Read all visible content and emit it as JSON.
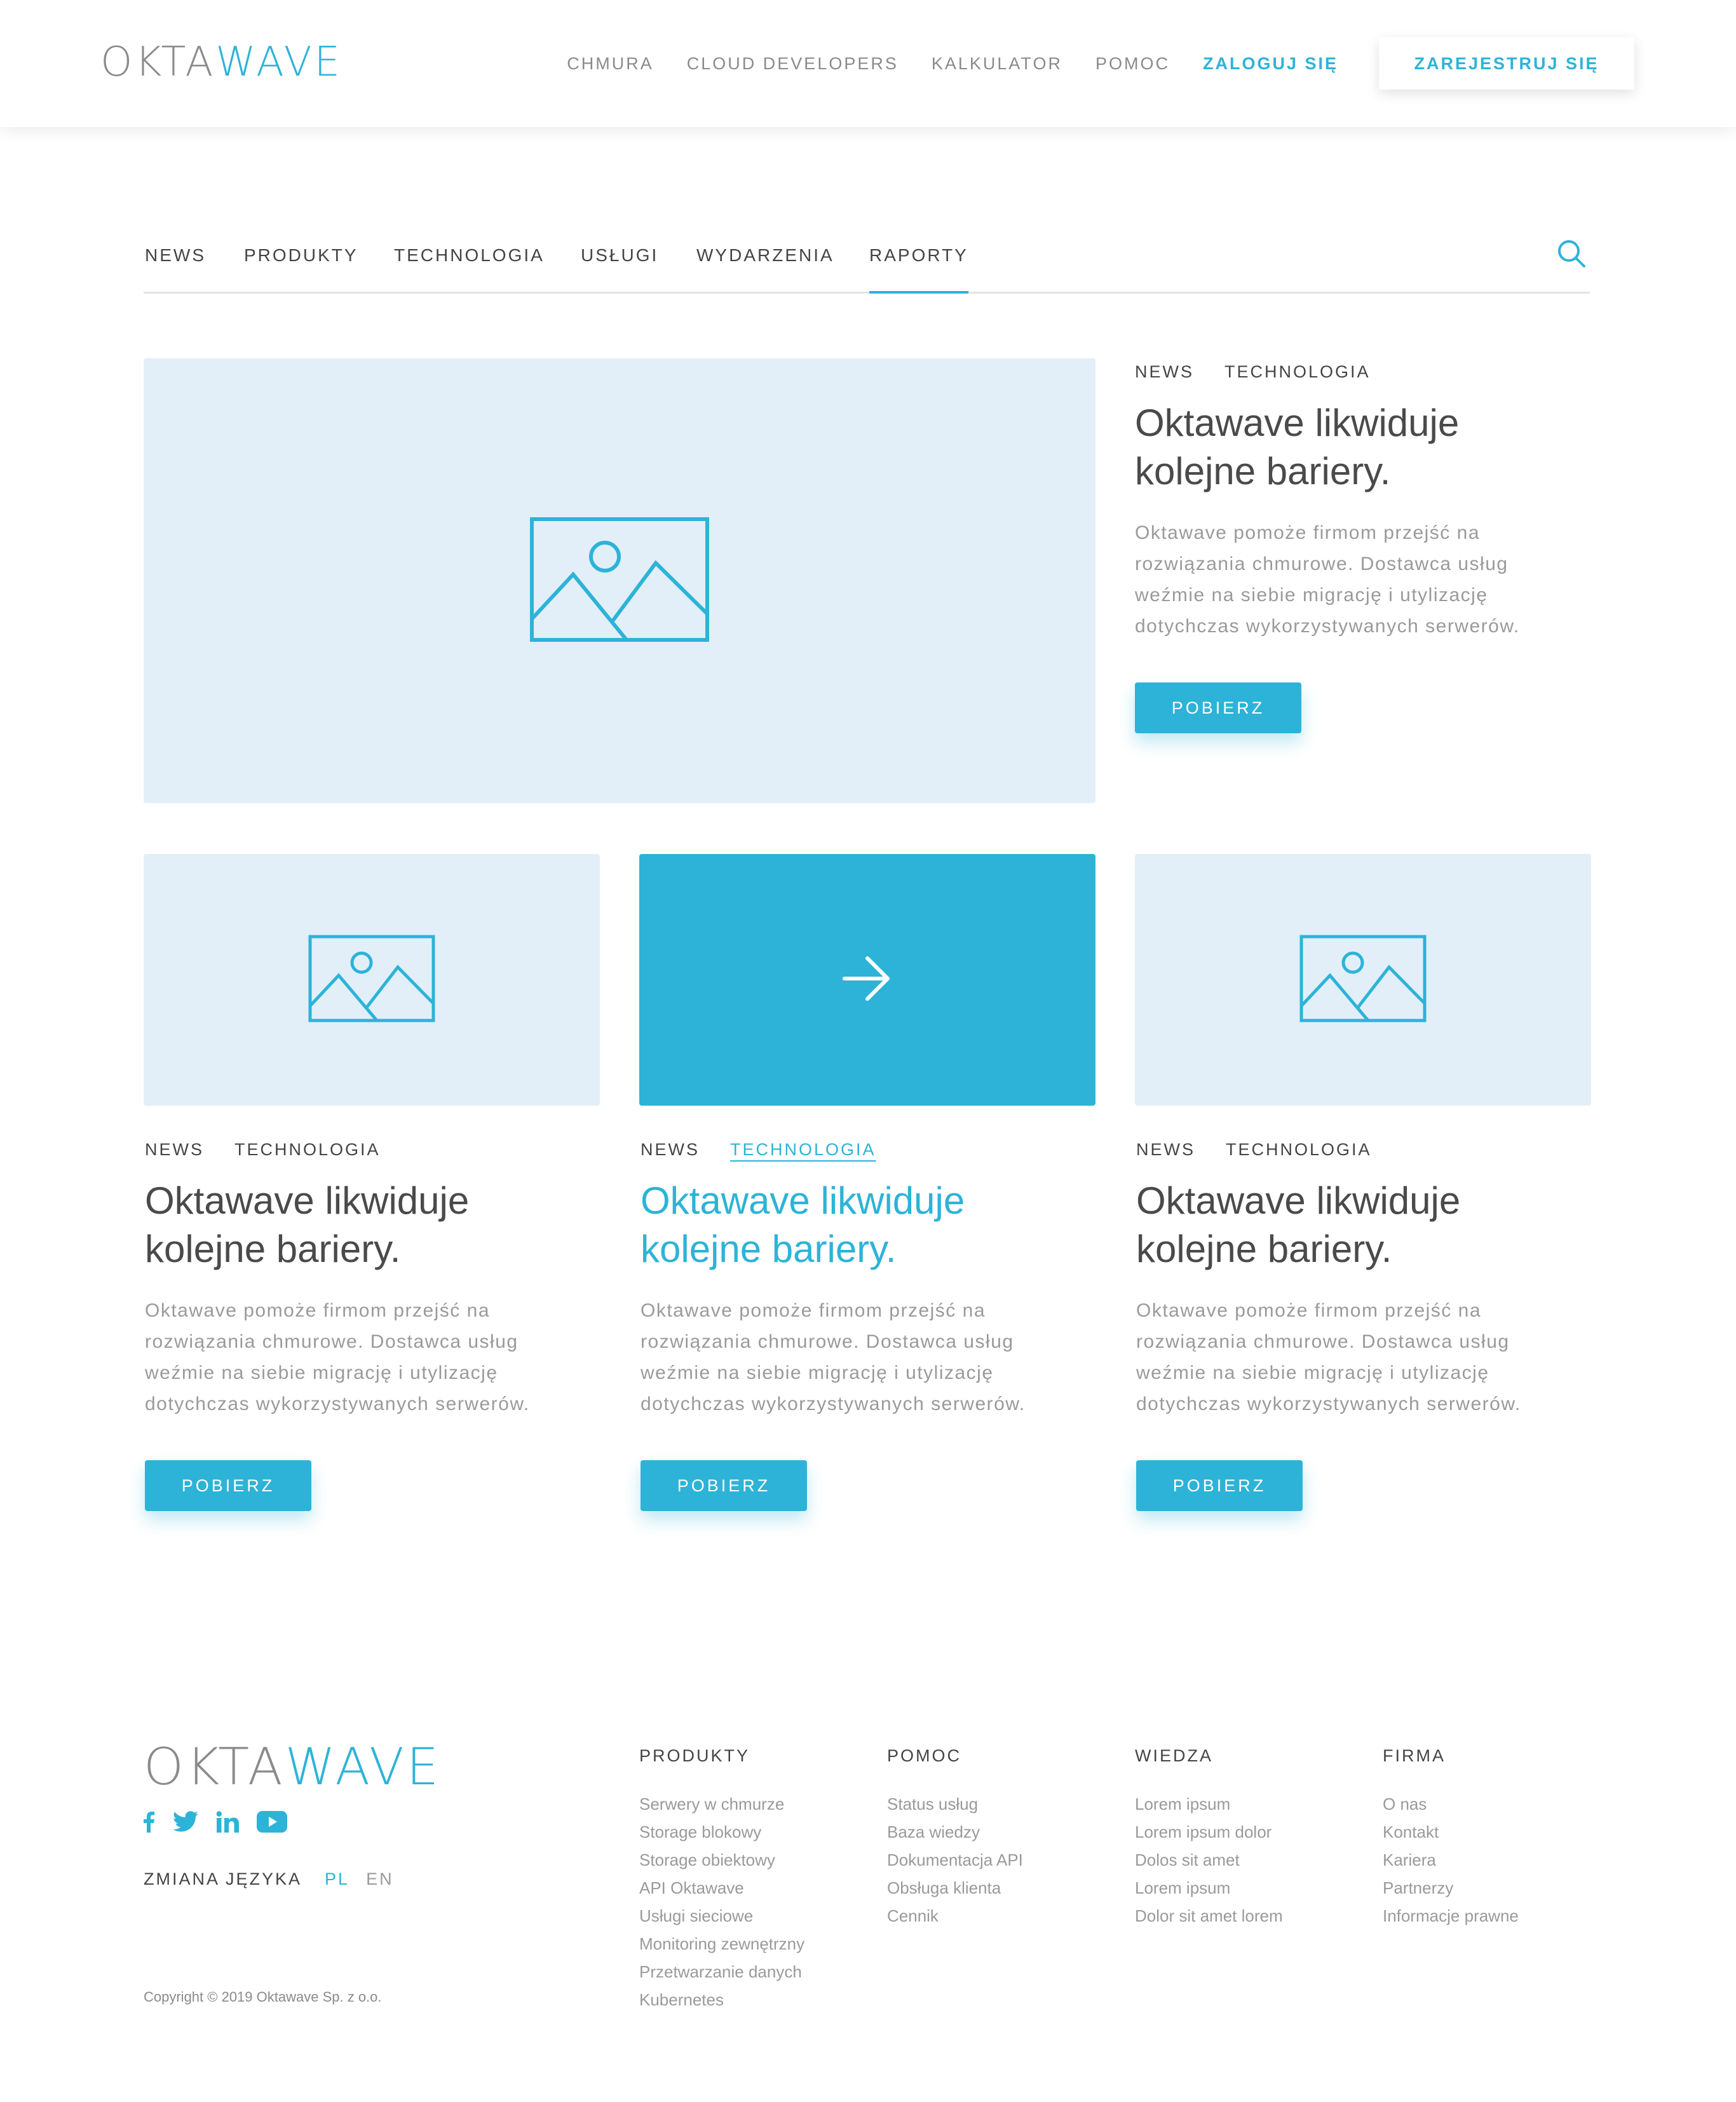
{
  "header": {
    "logo": {
      "part1": "OKTA",
      "part2": "WAVE"
    },
    "nav": [
      {
        "label": "CHMURA"
      },
      {
        "label": "CLOUD DEVELOPERS"
      },
      {
        "label": "KALKULATOR"
      },
      {
        "label": "POMOC"
      }
    ],
    "login": "ZALOGUJ SIĘ",
    "register": "ZAREJESTRUJ SIĘ"
  },
  "categories": {
    "tabs": [
      "NEWS",
      "PRODUKTY",
      "TECHNOLOGIA",
      "USŁUGI",
      "WYDARZENIA",
      "RAPORTY"
    ],
    "active": "RAPORTY"
  },
  "featured": {
    "tags": [
      "NEWS",
      "TECHNOLOGIA"
    ],
    "title_line1": "Oktawave likwiduje",
    "title_line2": "kolejne bariery.",
    "desc_lines": [
      "Oktawave pomoże firmom przejść na",
      "rozwiązania chmurowe. Dostawca usług",
      "weźmie na siebie migrację i utylizację",
      "dotychczas wykorzystywanych serwerów."
    ],
    "button": "POBIERZ"
  },
  "cards": [
    {
      "tags": [
        "NEWS",
        "TECHNOLOGIA"
      ],
      "title_line1": "Oktawave likwiduje",
      "title_line2": "kolejne bariery.",
      "desc_lines": [
        "Oktawave pomoże firmom przejść na",
        "rozwiązania chmurowe. Dostawca usług",
        "weźmie na siebie migrację i utylizację",
        "dotychczas wykorzystywanych serwerów."
      ],
      "button": "POBIERZ"
    },
    {
      "tags": [
        "NEWS",
        "TECHNOLOGIA"
      ],
      "title_line1": "Oktawave likwiduje",
      "title_line2": "kolejne bariery.",
      "desc_lines": [
        "Oktawave pomoże firmom przejść na",
        "rozwiązania chmurowe. Dostawca usług",
        "weźmie na siebie migrację i utylizację",
        "dotychczas wykorzystywanych serwerów."
      ],
      "button": "POBIERZ"
    },
    {
      "tags": [
        "NEWS",
        "TECHNOLOGIA"
      ],
      "title_line1": "Oktawave likwiduje",
      "title_line2": "kolejne bariery.",
      "desc_lines": [
        "Oktawave pomoże firmom przejść na",
        "rozwiązania chmurowe. Dostawca usług",
        "weźmie na siebie migrację i utylizację",
        "dotychczas wykorzystywanych serwerów."
      ],
      "button": "POBIERZ"
    }
  ],
  "footer": {
    "logo": {
      "part1": "OKTA",
      "part2": "WAVE"
    },
    "social_icons": [
      "facebook-icon",
      "twitter-icon",
      "linkedin-icon",
      "youtube-icon"
    ],
    "lang_label": "ZMIANA JĘZYKA",
    "lang_pl": "PL",
    "lang_en": "EN",
    "copyright": "Copyright © 2019 Oktawave Sp. z o.o.",
    "columns": [
      {
        "title": "PRODUKTY",
        "links": [
          "Serwery w chmurze",
          "Storage blokowy",
          "Storage obiektowy",
          "API Oktawave",
          "Usługi sieciowe",
          "Monitoring zewnętrzny",
          "Przetwarzanie danych",
          "Kubernetes"
        ]
      },
      {
        "title": "POMOC",
        "links": [
          "Status usług",
          "Baza wiedzy",
          "Dokumentacja API",
          "Obsługa klienta",
          "Cennik"
        ]
      },
      {
        "title": "WIEDZA",
        "links": [
          "Lorem ipsum",
          "Lorem ipsum dolor",
          "Dolos sit amet",
          "Lorem ipsum",
          "Dolor sit amet lorem"
        ]
      },
      {
        "title": "FIRMA",
        "links": [
          "O nas",
          "Kontakt",
          "Kariera",
          "Partnerzy",
          "Informacje prawne"
        ]
      }
    ]
  },
  "colors": {
    "accent": "#2db3d8",
    "placeholder_bg": "#e2eff8",
    "text": "#4a4a4a",
    "muted": "#9a9a9a"
  }
}
